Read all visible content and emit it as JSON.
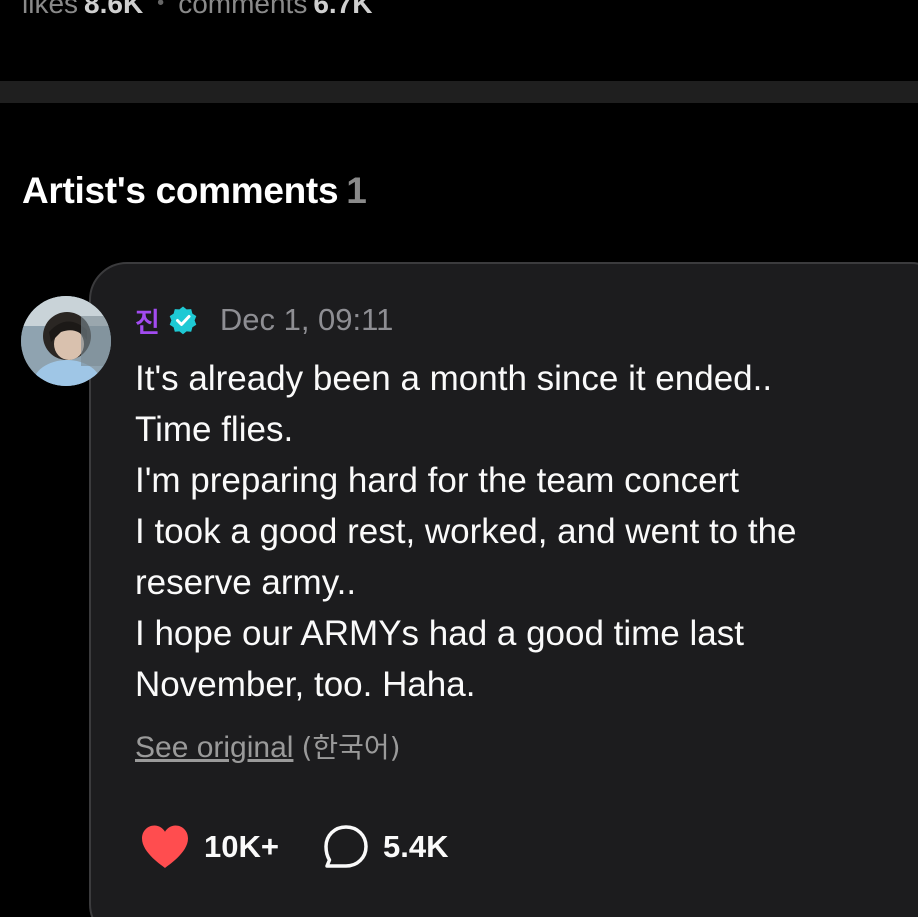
{
  "post_stats": {
    "likes_label": "likes",
    "likes_value": "8.6K",
    "comments_label": "comments",
    "comments_value": "6.7K"
  },
  "artist_comments": {
    "title": "Artist's comments",
    "count": "1"
  },
  "comment": {
    "author": "진",
    "verified_icon": "verified-badge-icon",
    "timestamp": "Dec 1, 09:11",
    "lines": [
      "It's already been a month since it ended..",
      "Time flies.",
      "I'm preparing hard for the team concert",
      "I took a good rest, worked, and went to the",
      "reserve army..",
      "I hope our ARMYs had a good time last",
      "November, too. Haha."
    ],
    "see_original": "See original",
    "original_language": "(한국어)",
    "likes": "10K+",
    "replies": "5.4K"
  },
  "colors": {
    "background": "#000000",
    "card": "#1c1c1e",
    "author": "#a24bf0",
    "verified": "#1ec9d4",
    "heart": "#ff4d4f",
    "muted": "#8e8e93"
  }
}
